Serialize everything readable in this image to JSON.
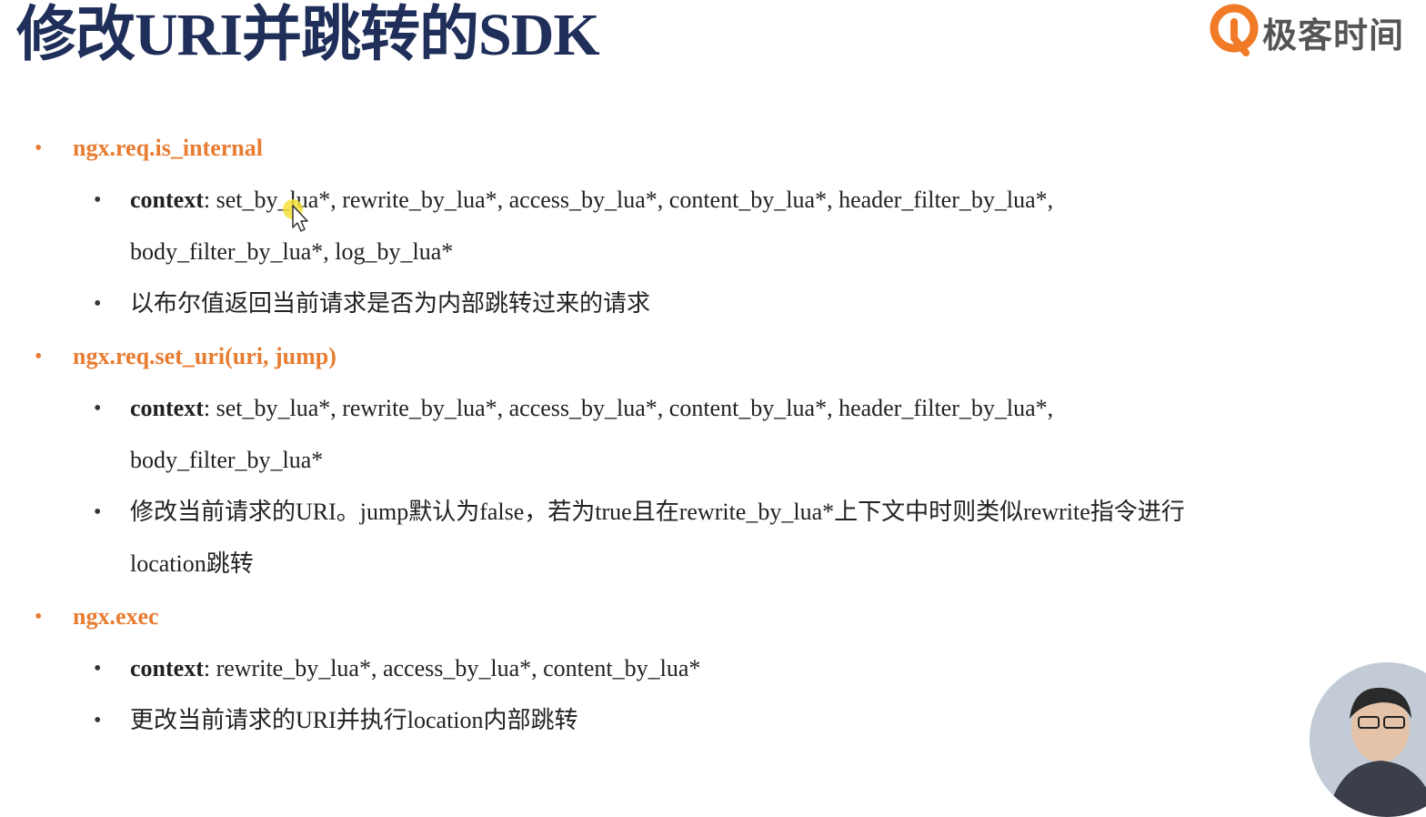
{
  "slide": {
    "title": "修改URI并跳转的SDK",
    "logo_text": "极客时间",
    "sections": [
      {
        "heading": "ngx.req.is_internal",
        "context_label": "context",
        "context_line1": ": set_by_lua*, rewrite_by_lua*, access_by_lua*, content_by_lua*, header_filter_by_lua*,",
        "context_line2": "body_filter_by_lua*, log_by_lua*",
        "desc_line1": "以布尔值返回当前请求是否为内部跳转过来的请求"
      },
      {
        "heading": "ngx.req.set_uri(uri, jump)",
        "context_label": "context",
        "context_line1": ": set_by_lua*, rewrite_by_lua*, access_by_lua*, content_by_lua*, header_filter_by_lua*,",
        "context_line2": "body_filter_by_lua*",
        "desc_line1": "修改当前请求的URI。jump默认为false，若为true且在rewrite_by_lua*上下文中时则类似rewrite指令进行",
        "desc_line2": "location跳转"
      },
      {
        "heading": "ngx.exec",
        "context_label": "context",
        "context_line1": ": rewrite_by_lua*, access_by_lua*, content_by_lua*",
        "desc_line1": "更改当前请求的URI并执行location内部跳转"
      }
    ],
    "colors": {
      "title": "#1f2f5a",
      "accent": "#e87c31",
      "text": "#222222"
    },
    "icons": {
      "logo": "geektime-logo-icon",
      "cursor": "mouse-cursor-icon"
    }
  }
}
